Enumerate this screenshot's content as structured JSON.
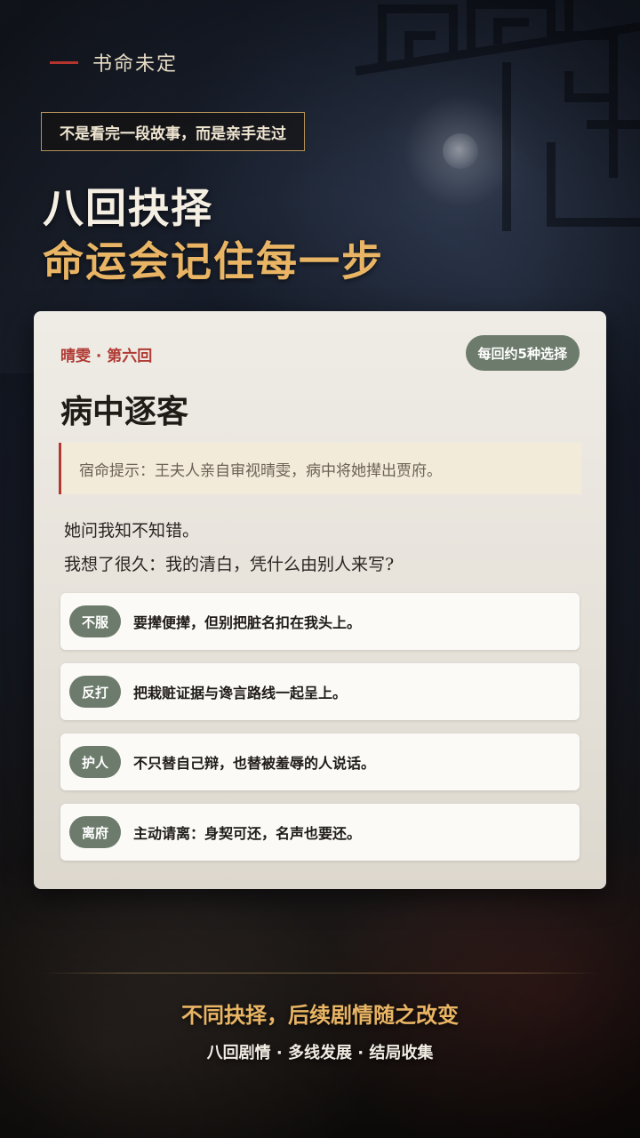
{
  "brand": {
    "name": "书命未定"
  },
  "tagline": "不是看完一段故事，而是亲手走过",
  "headline": {
    "line1": "八回抉择",
    "line2": "命运会记住每一步"
  },
  "card": {
    "chapter": "晴雯 · 第六回",
    "badge": "每回约5种选择",
    "title": "病中逐客",
    "hint": "宿命提示：王夫人亲自审视晴雯，病中将她撵出贾府。",
    "narration": [
      "她问我知不知错。",
      "我想了很久：我的清白，凭什么由别人来写?"
    ],
    "options": [
      {
        "tag": "不服",
        "text": "要撵便撵，但别把脏名扣在我头上。"
      },
      {
        "tag": "反打",
        "text": "把栽赃证据与谗言路线一起呈上。"
      },
      {
        "tag": "护人",
        "text": "不只替自己辩，也替被羞辱的人说话。"
      },
      {
        "tag": "离府",
        "text": "主动请离：身契可还，名声也要还。"
      }
    ]
  },
  "footer": {
    "headline": "不同抉择，后续剧情随之改变",
    "features": "八回剧情 · 多线发展 · 结局收集"
  },
  "colors": {
    "accent_red": "#b03a33",
    "accent_gold": "#e9b564",
    "tag_green": "#6c7b6b",
    "card_bg": "#ece8e1"
  }
}
